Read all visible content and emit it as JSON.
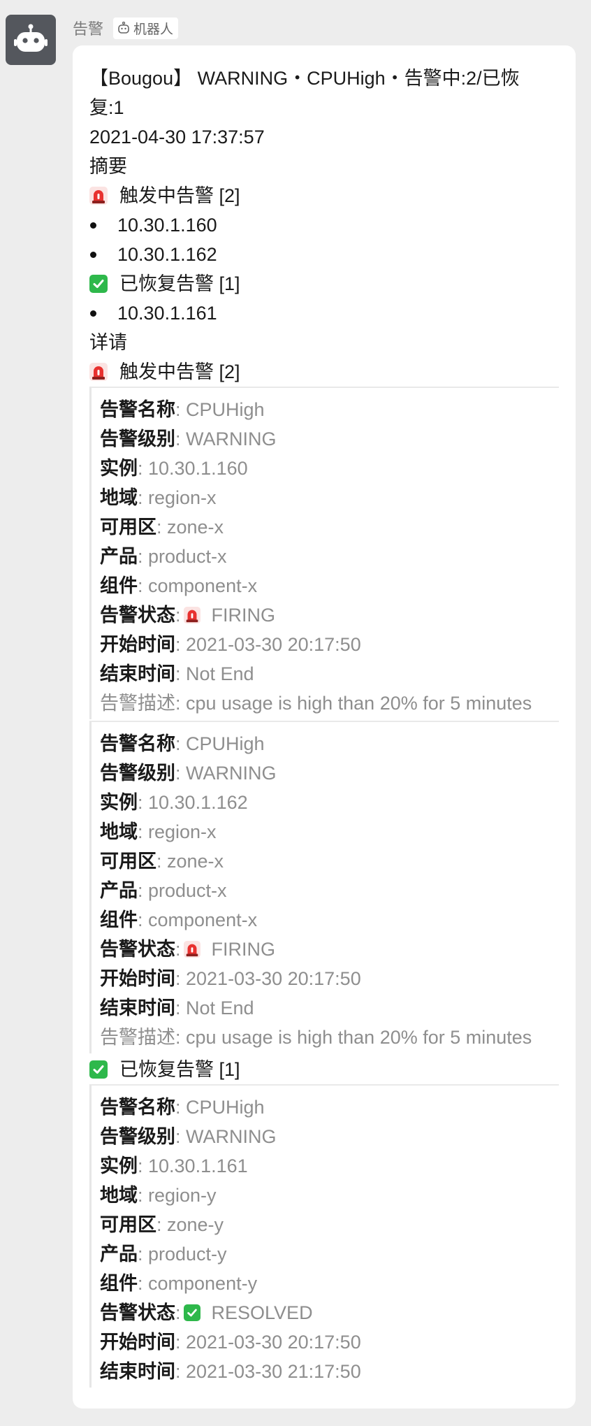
{
  "sender": {
    "name": "告警",
    "tag": "机器人"
  },
  "message": {
    "title": "【Bougou】 WARNING・CPUHigh・告警中:2/已恢复:1",
    "timestamp": "2021-04-30 17:37:57",
    "summary_label": "摘要",
    "summary_firing": {
      "label": "触发中告警 [2]",
      "items": [
        "10.30.1.160",
        "10.30.1.162"
      ]
    },
    "summary_resolved": {
      "label": "已恢复告警 [1]",
      "items": [
        "10.30.1.161"
      ]
    },
    "details_label": "详请",
    "details_firing_label": "触发中告警 [2]",
    "details_resolved_label": "已恢复告警 [1]",
    "labels": {
      "name": "告警名称",
      "level": "告警级别",
      "instance": "实例",
      "region": "地域",
      "zone": "可用区",
      "product": "产品",
      "component": "组件",
      "status": "告警状态",
      "start": "开始时间",
      "end": "结束时间",
      "desc": "告警描述"
    },
    "alerts": [
      {
        "name": ": CPUHigh",
        "level": ": WARNING",
        "instance": ": 10.30.1.160",
        "region": ": region-x",
        "zone": ": zone-x",
        "product": ": product-x",
        "component": ": component-x",
        "status": "FIRING",
        "start": ": 2021-03-30 20:17:50",
        "end": ": Not End",
        "desc": ": cpu usage is high than 20% for 5 minutes"
      },
      {
        "name": ": CPUHigh",
        "level": ": WARNING",
        "instance": ": 10.30.1.162",
        "region": ": region-x",
        "zone": ": zone-x",
        "product": ": product-x",
        "component": ": component-x",
        "status": "FIRING",
        "start": ": 2021-03-30 20:17:50",
        "end": ": Not End",
        "desc": ": cpu usage is high than 20% for 5 minutes"
      },
      {
        "name": ": CPUHigh",
        "level": ": WARNING",
        "instance": ": 10.30.1.161",
        "region": ": region-y",
        "zone": ": zone-y",
        "product": ": product-y",
        "component": ": component-y",
        "status": "RESOLVED",
        "start": ": 2021-03-30 20:17:50",
        "end": ": 2021-03-30 21:17:50"
      }
    ]
  },
  "colors": {
    "siren": "#e8312f",
    "check": "#2eb84b",
    "avatar_bg": "#54575d"
  }
}
